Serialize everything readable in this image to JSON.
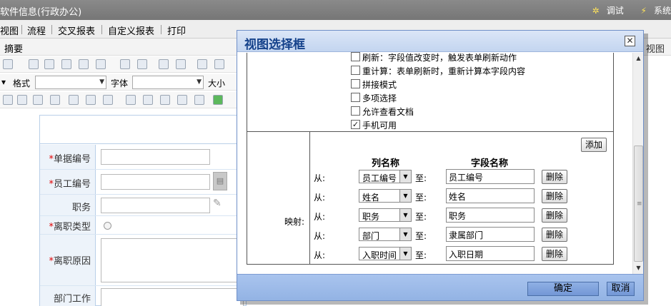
{
  "app": {
    "title": "软件信息(行政办公)",
    "top_tools": [
      {
        "icon": "gear-icon",
        "label": "调试"
      },
      {
        "icon": "lightning-icon",
        "label": "系统"
      }
    ]
  },
  "menubar": {
    "items": [
      "视图",
      "流程",
      "交叉报表",
      "自定义报表",
      "打印"
    ]
  },
  "subbar": {
    "left": "摘要",
    "right": "视图"
  },
  "toolbar": {
    "format_label": "格式",
    "font_label": "字体",
    "size_label": "大小"
  },
  "form": {
    "fields": [
      {
        "label": "单据编号",
        "required": true
      },
      {
        "label": "员工编号",
        "required": true
      },
      {
        "label": "职务",
        "required": false
      },
      {
        "label": "离职类型",
        "required": true
      },
      {
        "label": "离职原因",
        "required": true
      },
      {
        "label": "部门工作",
        "required": false
      }
    ],
    "required_mark": "*"
  },
  "dialog": {
    "title": "视图选择框",
    "close": "✕",
    "options": [
      {
        "label": "刷新：字段值改变时，触发表单刷新动作",
        "checked": false
      },
      {
        "label": "重计算：表单刷新时，重新计算本字段内容",
        "checked": false
      },
      {
        "label": "拼接模式",
        "checked": false
      },
      {
        "label": "多项选择",
        "checked": false
      },
      {
        "label": "允许查看文档",
        "checked": false
      },
      {
        "label": "手机可用",
        "checked": true
      }
    ],
    "mapping_label": "映射:",
    "add_button": "添加",
    "col_header": "列名称",
    "field_header": "字段名称",
    "from_label": "从:",
    "to_label": "至:",
    "delete_button": "删除",
    "mappings": [
      {
        "column": "员工编号",
        "field": "员工编号"
      },
      {
        "column": "姓名",
        "field": "姓名"
      },
      {
        "column": "职务",
        "field": "职务"
      },
      {
        "column": "部门",
        "field": "隶属部门"
      },
      {
        "column": "入职时间",
        "field": "入职日期"
      }
    ],
    "ok_button": "确定",
    "cancel_button": "取消"
  }
}
